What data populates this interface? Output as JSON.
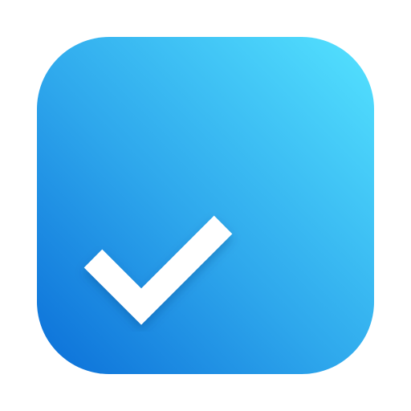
{
  "icon": {
    "name": "checkmark-app-icon",
    "glyph": "checkmark-icon"
  },
  "colors": {
    "gradient_top_right": "#54E2FF",
    "gradient_mid": "#2EA7EC",
    "gradient_bottom_left": "#0B6FD8",
    "check": "#FFFFFF",
    "background": "#FFFFFF"
  }
}
